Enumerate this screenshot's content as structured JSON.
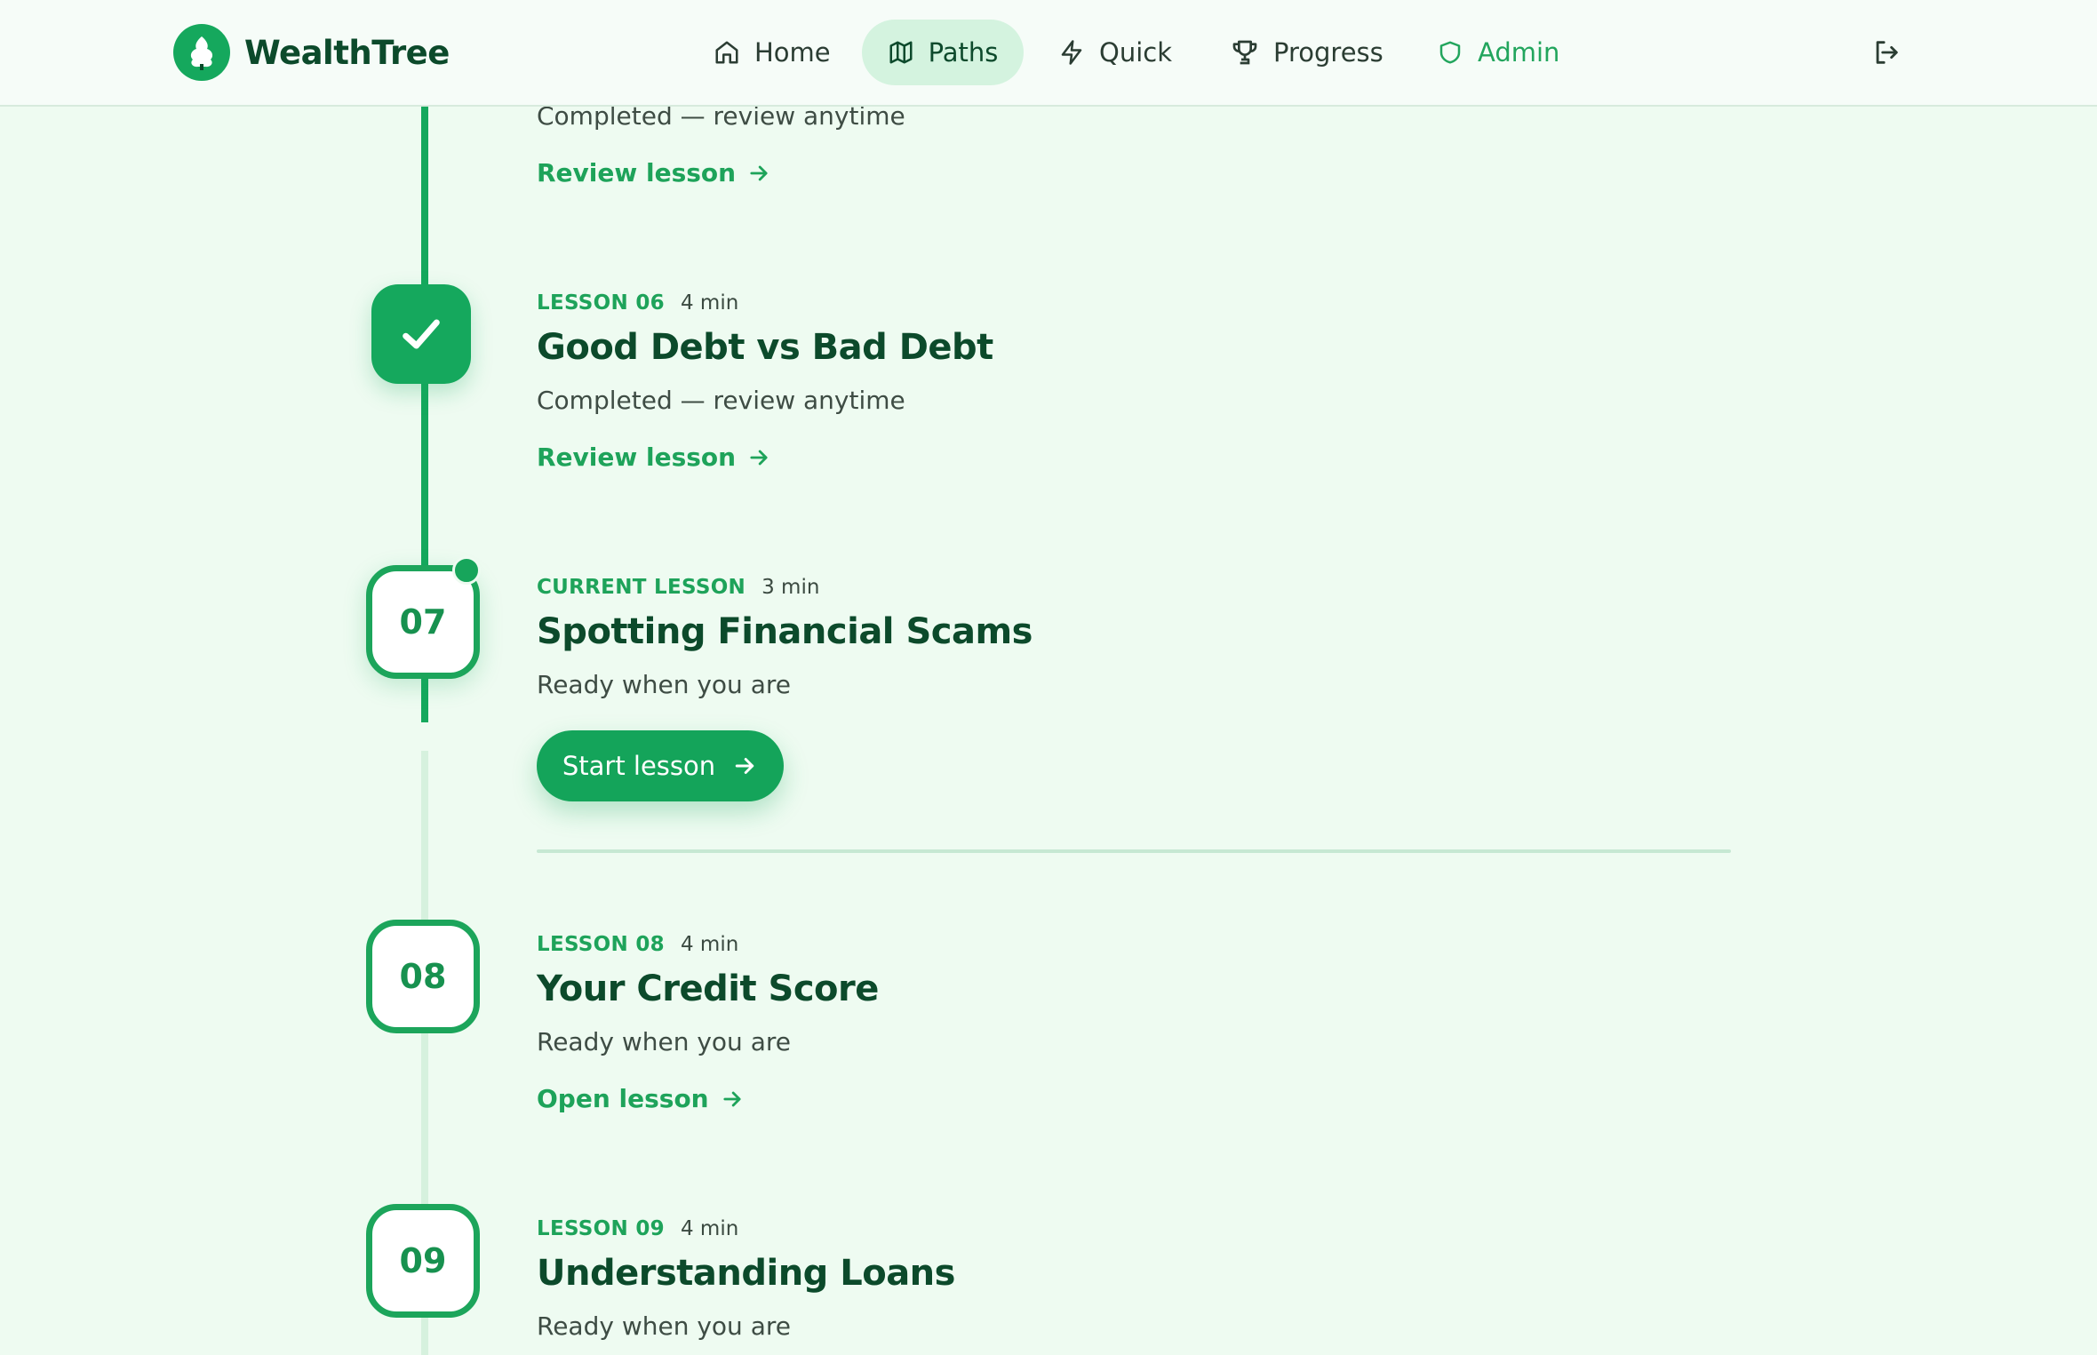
{
  "brand": {
    "name": "WealthTree"
  },
  "nav": {
    "items": [
      {
        "label": "Home",
        "icon": "home-icon"
      },
      {
        "label": "Paths",
        "icon": "map-icon",
        "active": true
      },
      {
        "label": "Quick",
        "icon": "lightning-icon"
      },
      {
        "label": "Progress",
        "icon": "trophy-icon"
      },
      {
        "label": "Admin",
        "icon": "shield-icon"
      }
    ],
    "logout_icon": "logout-icon"
  },
  "lessons": [
    {
      "status": "Completed — review anytime",
      "action": "Review lesson",
      "state": "completed"
    },
    {
      "tag": "LESSON 06",
      "duration": "4 min",
      "title": "Good Debt vs Bad Debt",
      "status": "Completed — review anytime",
      "action": "Review lesson",
      "state": "completed"
    },
    {
      "number": "07",
      "tag": "CURRENT LESSON",
      "duration": "3 min",
      "title": "Spotting Financial Scams",
      "status": "Ready when you are",
      "action": "Start lesson",
      "state": "current"
    },
    {
      "number": "08",
      "tag": "LESSON 08",
      "duration": "4 min",
      "title": "Your Credit Score",
      "status": "Ready when you are",
      "action": "Open lesson",
      "state": "upcoming"
    },
    {
      "number": "09",
      "tag": "LESSON 09",
      "duration": "4 min",
      "title": "Understanding Loans",
      "status": "Ready when you are",
      "state": "upcoming"
    }
  ],
  "colors": {
    "accent": "#15a85d",
    "background": "#eefbf1",
    "title_text": "#0c4a2b"
  }
}
